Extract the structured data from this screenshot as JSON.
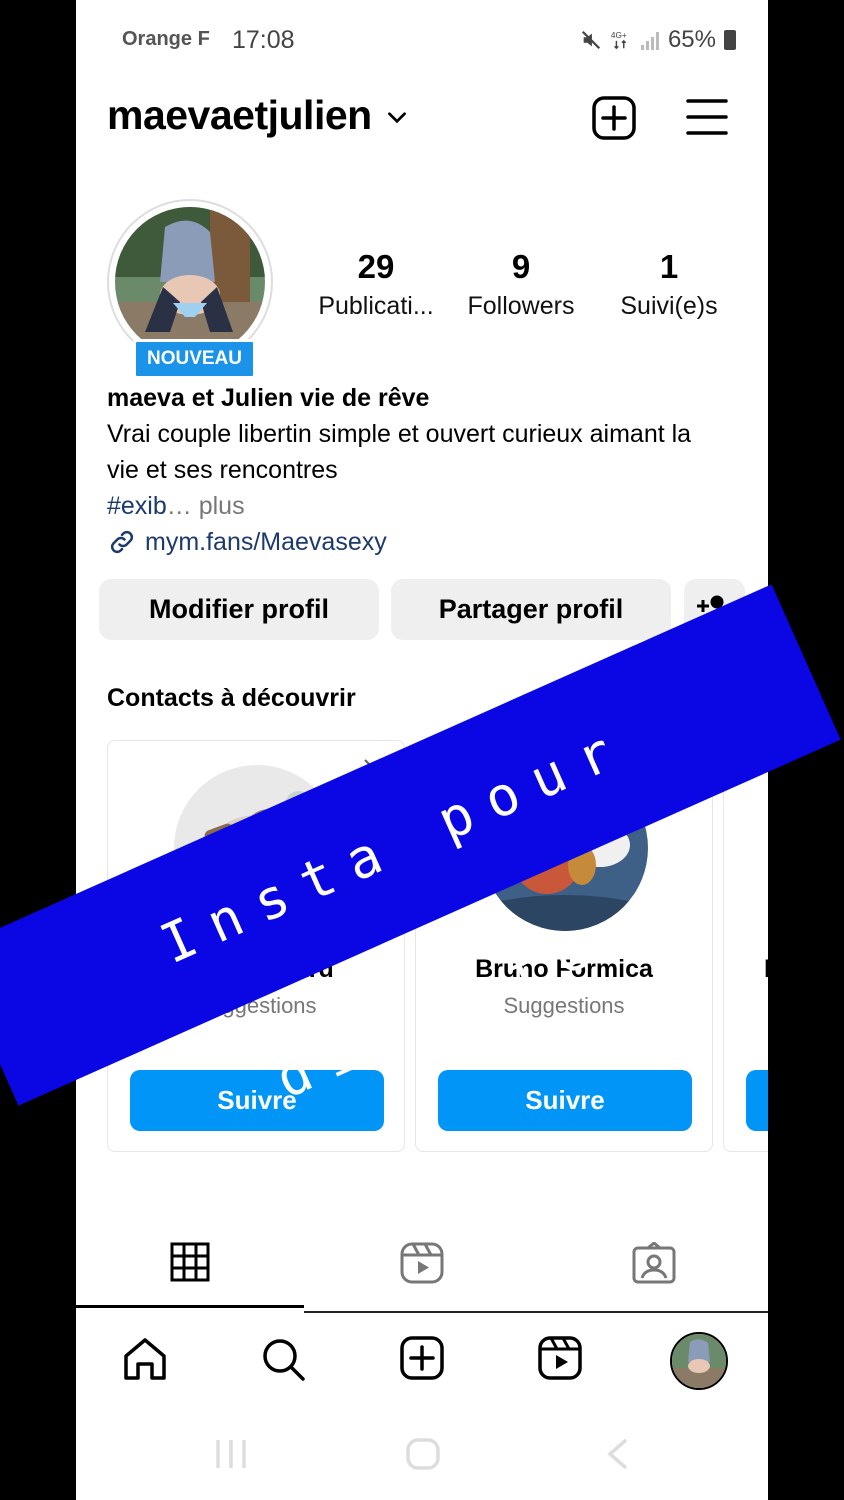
{
  "status_bar": {
    "carrier": "Orange F",
    "time": "17:08",
    "battery": "65%"
  },
  "header": {
    "username": "maevaetjulien"
  },
  "profile": {
    "badge": "NOUVEAU",
    "stats": [
      {
        "num": "29",
        "label": "Publicati..."
      },
      {
        "num": "9",
        "label": "Followers"
      },
      {
        "num": "1",
        "label": "Suivi(e)s"
      }
    ],
    "name": "maeva et Julien vie de rêve",
    "bio_line1": "Vrai couple libertin simple et ouvert curieux aimant la",
    "bio_line2": "vie et ses rencontres",
    "hashtag": "#exib",
    "more": "… plus",
    "link": "mym.fans/Maevasexy"
  },
  "actions": {
    "edit": "Modifier profil",
    "share": "Partager profil"
  },
  "suggestions": {
    "title": "Contacts à découvrir",
    "cards": [
      {
        "name": "…as Goinard",
        "sub": "Suggestions",
        "button": "Suivre"
      },
      {
        "name": "Bruno Formica",
        "sub": "Suggestions",
        "button": "Suivre"
      }
    ]
  },
  "banner": {
    "text": "Insta pour discuter"
  },
  "colors": {
    "follow_blue": "#0095f6",
    "banner_blue": "#0a07e4",
    "badge_blue": "#1a93e8"
  }
}
